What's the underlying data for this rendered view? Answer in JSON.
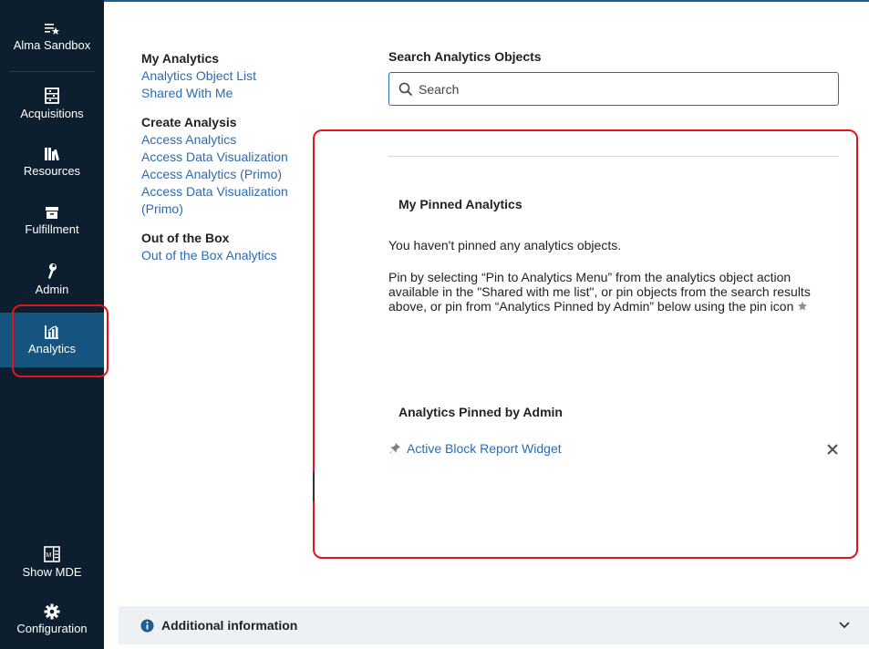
{
  "sidebar": {
    "items": [
      {
        "label": "Alma Sandbox",
        "icon": "list-star-icon"
      },
      {
        "label": "Acquisitions",
        "icon": "abacus-icon"
      },
      {
        "label": "Resources",
        "icon": "books-icon"
      },
      {
        "label": "Fulfillment",
        "icon": "archive-icon"
      },
      {
        "label": "Admin",
        "icon": "wrench-icon"
      },
      {
        "label": "Analytics",
        "icon": "chart-icon",
        "active": true
      },
      {
        "label": "Show MDE",
        "icon": "mde-icon"
      },
      {
        "label": "Configuration",
        "icon": "gear-icon"
      }
    ]
  },
  "menu": {
    "my_analytics": {
      "heading": "My Analytics",
      "links": [
        "Analytics Object List",
        "Shared With Me"
      ]
    },
    "create_analysis": {
      "heading": "Create Analysis",
      "links": [
        "Access Analytics",
        "Access Data Visualization",
        "Access Analytics (Primo)",
        "Access Data Visualization (Primo)"
      ]
    },
    "out_of_box": {
      "heading": "Out of the Box",
      "links": [
        "Out of the Box Analytics"
      ]
    }
  },
  "search": {
    "title": "Search Analytics Objects",
    "placeholder": "Search",
    "value": ""
  },
  "pinned": {
    "title": "My Pinned Analytics",
    "empty_text": "You haven't pinned any analytics objects.",
    "hint": "Pin by selecting “Pin to Analytics Menu” from the analytics object action available in the \"Shared with me list\", or pin objects from the search results above, or pin from “Analytics Pinned by Admin” below using the pin icon"
  },
  "admin_pinned": {
    "title": "Analytics Pinned by Admin",
    "items": [
      {
        "label": "Active Block Report Widget"
      }
    ]
  },
  "additional": {
    "label": "Additional information"
  },
  "colors": {
    "sidebar_bg": "#0d1f2f",
    "sidebar_active": "#14547e",
    "link": "#2c6bb0",
    "highlight": "#e3141b"
  }
}
